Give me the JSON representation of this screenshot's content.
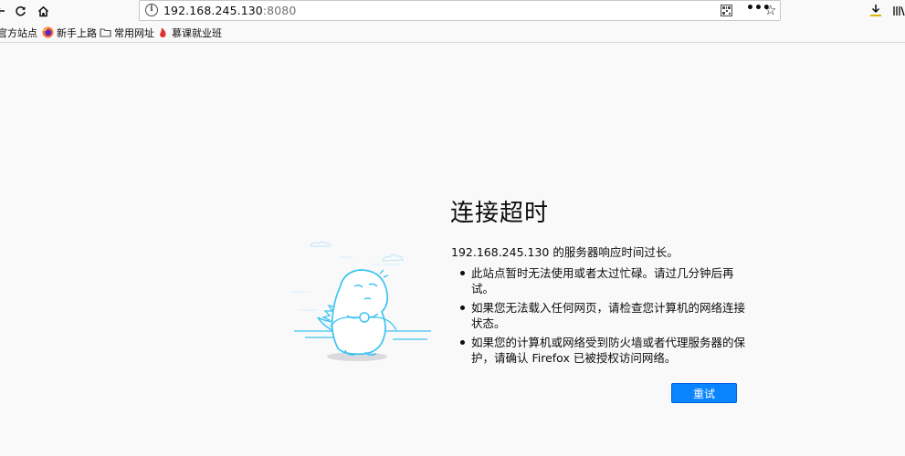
{
  "toolbar": {
    "url_host": "192.168.245.130",
    "url_port": ":8080"
  },
  "bookmarks": [
    {
      "label": "官方站点"
    },
    {
      "label": "新手上路"
    },
    {
      "label": "常用网址"
    },
    {
      "label": "慕课就业班"
    }
  ],
  "error": {
    "title": "连接超时",
    "description": "192.168.245.130 的服务器响应时间过长。",
    "bullets": [
      "此站点暂时无法使用或者太过忙碌。请过几分钟后再试。",
      "如果您无法载入任何网页，请检查您计算机的网络连接状态。",
      "如果您的计算机或网络受到防火墙或者代理服务器的保护，请确认 Firefox 已被授权访问网络。"
    ],
    "retry_label": "重试"
  },
  "colors": {
    "accent": "#0a84ff",
    "illustration": "#3fc4f1"
  },
  "icons": [
    "back-icon",
    "reload-icon",
    "home-icon",
    "info-icon",
    "qr-code-icon",
    "page-actions-icon",
    "bookmark-star-icon",
    "downloads-icon",
    "library-icon",
    "firefox-icon",
    "folder-icon",
    "flame-icon",
    "dino-illustration"
  ]
}
